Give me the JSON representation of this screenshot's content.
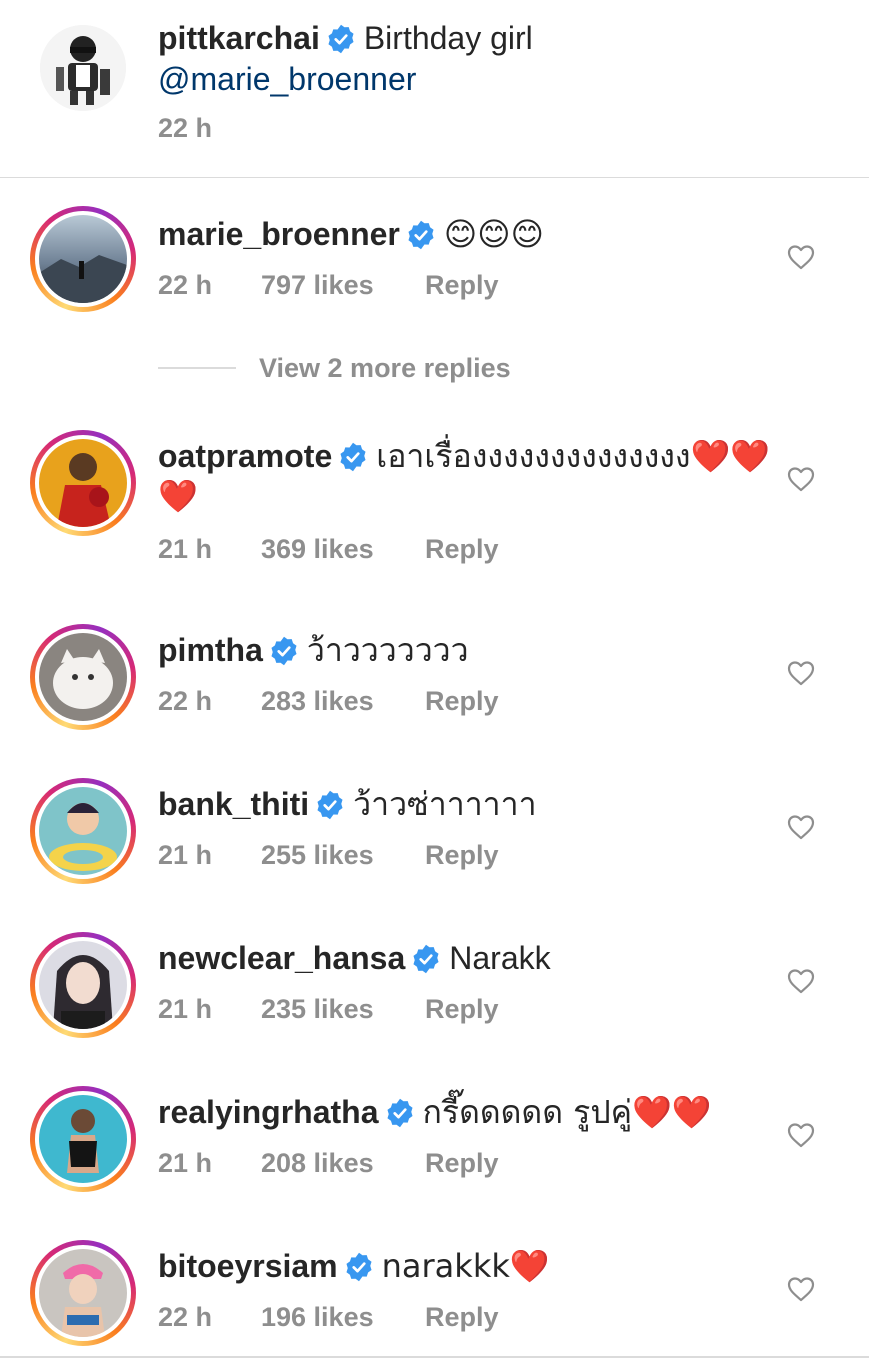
{
  "caption": {
    "username": "pittkarchai",
    "text": "Birthday girl",
    "mention": "@marie_broenner",
    "time": "22 h"
  },
  "colors": {
    "text": "#262626",
    "secondary": "#8e8e8e",
    "mention": "#00376b",
    "verified": "#3897f0",
    "heart_red": "#e0222e",
    "divider": "#dbdbdb"
  },
  "comments": [
    {
      "username": "marie_broenner",
      "text": "😊😊😊",
      "time": "22 h",
      "likes": "797 likes",
      "reply": "Reply"
    },
    {
      "username": "oatpramote",
      "text": "เอาเรื่องงงงงงงงงงงงงง❤️❤️❤️",
      "time": "21 h",
      "likes": "369 likes",
      "reply": "Reply"
    },
    {
      "username": "pimtha",
      "text": "ว้าววววววว",
      "time": "22 h",
      "likes": "283 likes",
      "reply": "Reply"
    },
    {
      "username": "bank_thiti",
      "text": "ว้าวซ่าาาาาา",
      "time": "21 h",
      "likes": "255 likes",
      "reply": "Reply"
    },
    {
      "username": "newclear_hansa",
      "text": "Narakk",
      "time": "21 h",
      "likes": "235 likes",
      "reply": "Reply"
    },
    {
      "username": "realyingrhatha",
      "text": "กรี๊ดดดดด รูปคู่❤️❤️",
      "time": "21 h",
      "likes": "208 likes",
      "reply": "Reply"
    },
    {
      "username": "bitoeyrsiam",
      "text": "narakkk❤️",
      "time": "22 h",
      "likes": "196 likes",
      "reply": "Reply"
    }
  ],
  "view_replies": "View 2 more replies",
  "icons": {
    "verified": "verified-badge-icon",
    "like": "heart-outline-icon"
  }
}
